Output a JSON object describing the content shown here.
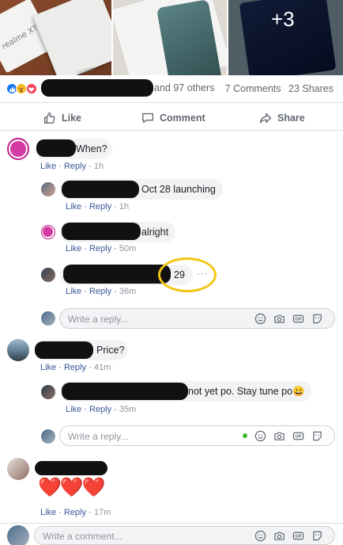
{
  "photos": {
    "brand_text": "realme XT",
    "brand_small": "realme",
    "more_count": "+3"
  },
  "reactions": {
    "others_text": "and 97 others",
    "comments_count": "7 Comments",
    "shares_count": "23 Shares"
  },
  "actions": {
    "like": "Like",
    "comment": "Comment",
    "share": "Share"
  },
  "comments": [
    {
      "text": "When?",
      "like": "Like",
      "reply": "Reply",
      "time": "1h"
    },
    {
      "text": "Oct 28 launching",
      "like": "Like",
      "reply": "Reply",
      "time": "1h"
    },
    {
      "text": "alright",
      "like": "Like",
      "reply": "Reply",
      "time": "50m"
    },
    {
      "text": "29",
      "like": "Like",
      "reply": "Reply",
      "time": "36m",
      "more": "···"
    },
    {
      "text": "Price?",
      "like": "Like",
      "reply": "Reply",
      "time": "41m"
    },
    {
      "text": "not yet po. Stay tune po😀",
      "like": "Like",
      "reply": "Reply",
      "time": "35m"
    },
    {
      "text": "❤️❤️❤️",
      "like": "Like",
      "reply": "Reply",
      "time": "17m"
    }
  ],
  "reply_placeholder": "Write a reply...",
  "comment_placeholder": "Write a comment...",
  "colors": {
    "link": "#385898",
    "muted": "#90949c",
    "annotation": "#f3c515",
    "fb_blue": "#1877f2"
  }
}
